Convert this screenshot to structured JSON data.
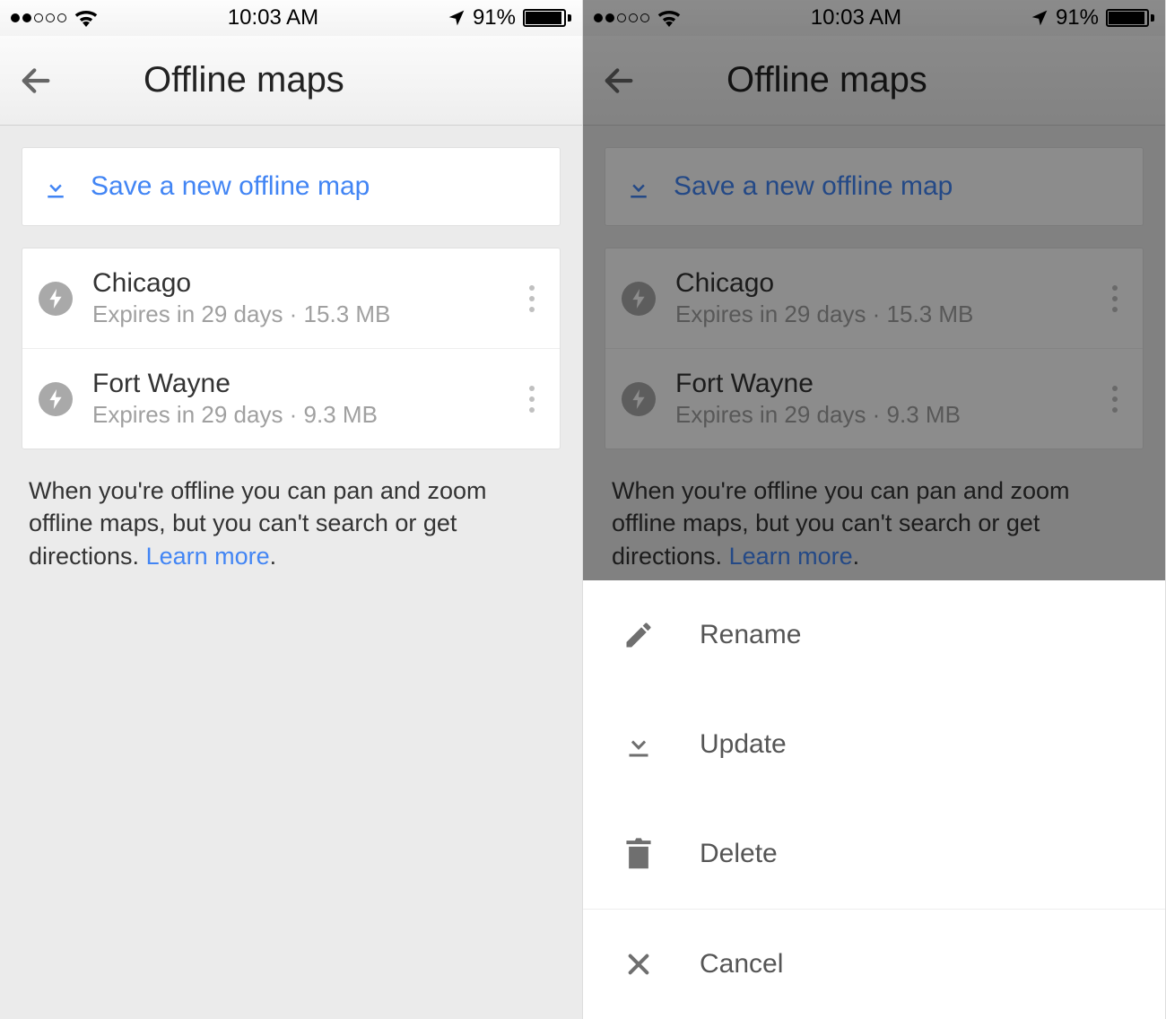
{
  "status": {
    "time": "10:03 AM",
    "battery_pct": "91%"
  },
  "header": {
    "title": "Offline maps"
  },
  "save_button": {
    "label": "Save a new offline map"
  },
  "maps": [
    {
      "name": "Chicago",
      "subtitle": "Expires in 29 days · 15.3 MB"
    },
    {
      "name": "Fort Wayne",
      "subtitle": "Expires in 29 days · 9.3 MB"
    }
  ],
  "hint": {
    "text": "When you're offline you can pan and zoom offline maps, but you can't search or get directions. ",
    "learn_more": "Learn more"
  },
  "sheet": {
    "rename": "Rename",
    "update": "Update",
    "delete": "Delete",
    "cancel": "Cancel"
  }
}
